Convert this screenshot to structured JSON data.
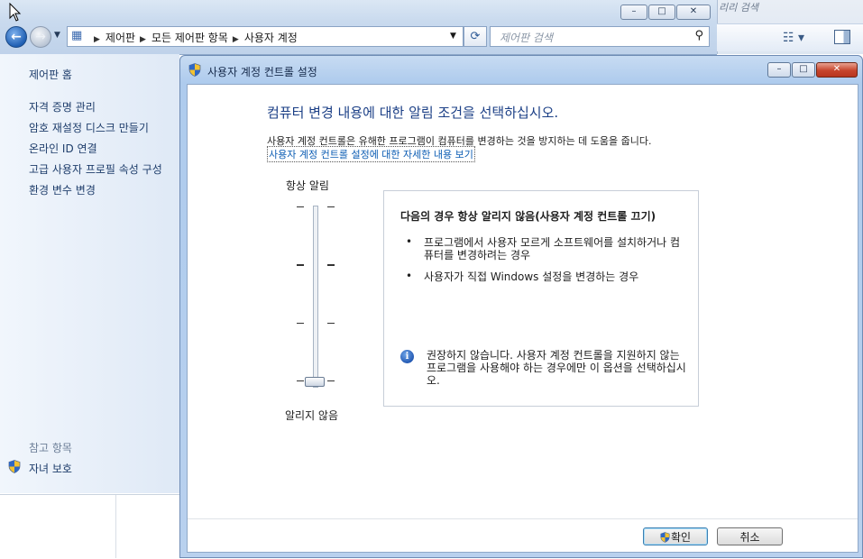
{
  "background_window": {
    "caption_buttons": [
      "–",
      "□",
      "✕"
    ],
    "breadcrumbs": [
      "제어판",
      "모든 제어판 항목",
      "사용자 계정"
    ],
    "search_placeholder": "제어판 검색",
    "right_window_search_text": "리리 검색",
    "nav_icons": {
      "back": "back-arrow-icon",
      "forward": "forward-arrow-icon",
      "refresh": "refresh-icon",
      "search": "magnifier-icon"
    }
  },
  "left_pane": {
    "home": "제어판 홈",
    "links": [
      "자격 증명 관리",
      "암호 재설정 디스크 만들기",
      "온라인 ID 연결",
      "고급 사용자 프로필 속성 구성",
      "환경 변수 변경"
    ],
    "see_also_title": "참고 항목",
    "see_also_items": [
      "자녀 보호"
    ]
  },
  "dialog": {
    "title": "사용자 계정 컨트롤 설정",
    "caption_buttons": [
      "–",
      "□",
      "✕"
    ],
    "heading": "컴퓨터 변경 내용에 대한 알림 조건을 선택하십시오.",
    "description": "사용자 계정 컨트롤은 유해한 프로그램이 컴퓨터를 변경하는 것을 방지하는 데 도움을 줍니다.",
    "learn_more_link": "사용자 계정 컨트롤 설정에 대한 자세한 내용 보기",
    "slider": {
      "top_label": "항상 알림",
      "bottom_label": "알리지 않음",
      "levels": 4,
      "selected_level": 1
    },
    "info": {
      "title": "다음의 경우 항상 알리지 않음(사용자 계정 컨트롤 끄기)",
      "bullets": [
        "프로그램에서 사용자 모르게 소프트웨어를 설치하거나 컴퓨터를 변경하려는 경우",
        "사용자가 직접 Windows 설정을 변경하는 경우"
      ],
      "warning": "권장하지 않습니다. 사용자 계정 컨트롤을 지원하지 않는 프로그램을 사용해야 하는 경우에만 이 옵션을 선택하십시오."
    },
    "ok_button": "확인",
    "cancel_button": "취소"
  },
  "colors": {
    "heading_blue": "#1b3f86",
    "link_blue": "#0b5cb3",
    "close_red": "#c6442c"
  }
}
